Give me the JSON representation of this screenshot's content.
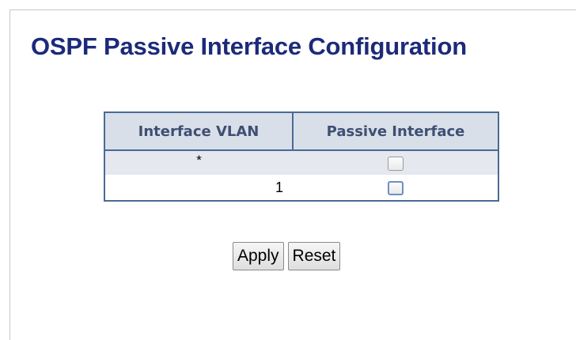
{
  "page": {
    "title": "OSPF Passive Interface Configuration"
  },
  "table": {
    "headers": {
      "vlan": "Interface VLAN",
      "passive": "Passive Interface"
    },
    "rows": [
      {
        "vlan": "*",
        "passive_checked": false
      },
      {
        "vlan": "1",
        "passive_checked": false
      }
    ]
  },
  "buttons": {
    "apply": "Apply",
    "reset": "Reset"
  },
  "colors": {
    "title": "#1c2a7a",
    "table_border": "#4a6a96",
    "header_bg": "#d9dfe9",
    "header_text": "#3f4f73",
    "global_row_bg": "#e5e8ee"
  }
}
